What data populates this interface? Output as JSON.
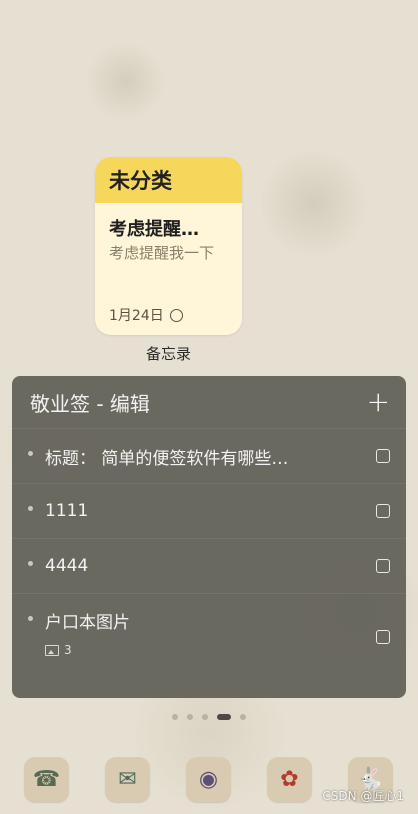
{
  "memo_widget": {
    "category": "未分类",
    "note_title": "考虑提醒…",
    "note_text": "考虑提醒我一下",
    "date": "1月24日",
    "label": "备忘录"
  },
  "notes_widget": {
    "title": "敬业签 - 编辑",
    "add_icon": "+",
    "items": [
      {
        "text": "标题： 简单的便签软件有哪些…"
      },
      {
        "text": "1111"
      },
      {
        "text": "4444"
      },
      {
        "text": "户口本图片",
        "image_count": "3"
      }
    ]
  },
  "page_indicator": {
    "count": 5,
    "active_index": 3
  },
  "dock": {
    "apps": [
      {
        "icon": "telephone-icon",
        "glyph": "☎"
      },
      {
        "icon": "message-icon",
        "glyph": "✉"
      },
      {
        "icon": "camera-icon",
        "glyph": "◉"
      },
      {
        "icon": "flower-icon",
        "glyph": "✿"
      },
      {
        "icon": "rabbit-icon",
        "glyph": "🐇"
      }
    ]
  },
  "watermark": "CSDN @匠心1"
}
